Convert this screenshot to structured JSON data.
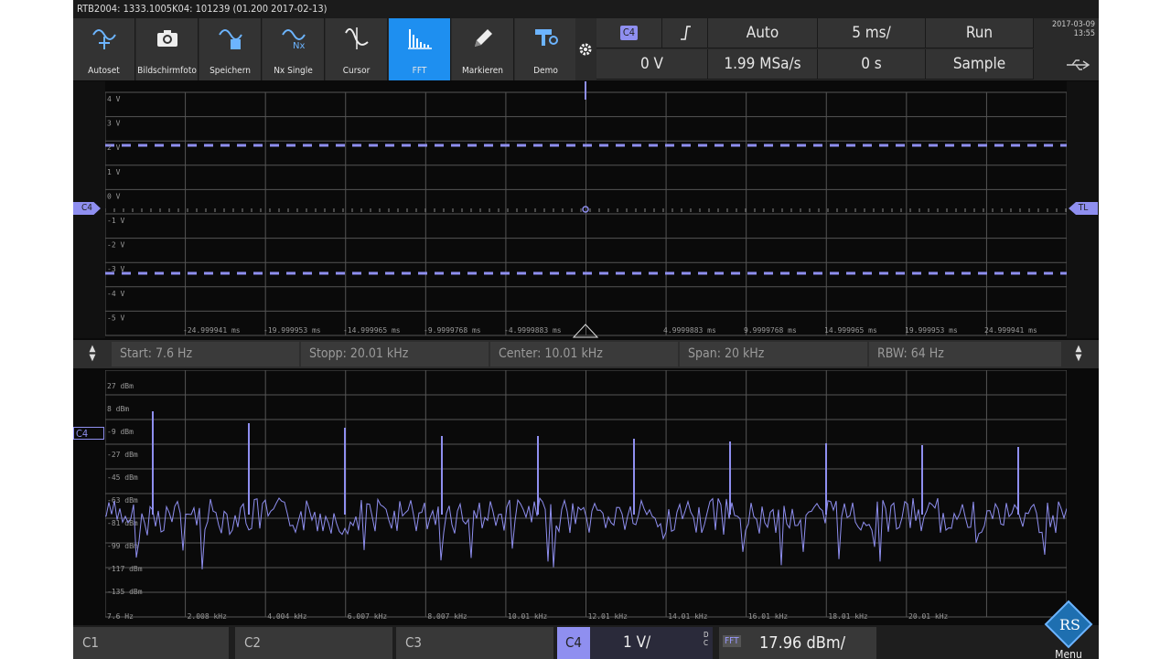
{
  "title_bar": "RTB2004: 1333.1005K04: 101239 (01.200 2017-02-13)",
  "toolbar": {
    "buttons": [
      {
        "label": "Autoset",
        "icon": "autoset-icon"
      },
      {
        "label": "Bildschirmfoto",
        "icon": "camera-icon"
      },
      {
        "label": "Speichern",
        "icon": "save-waveform-icon"
      },
      {
        "label": "Nx Single",
        "icon": "nx-single-icon"
      },
      {
        "label": "Cursor",
        "icon": "cursor-icon"
      },
      {
        "label": "FFT",
        "icon": "fft-icon"
      },
      {
        "label": "Markieren",
        "icon": "pencil-icon"
      },
      {
        "label": "Demo",
        "icon": "demo-icon"
      }
    ],
    "gear_icon": "gear-icon",
    "trigger": {
      "source": "C4",
      "slope_icon": "rising-edge-icon",
      "mode": "Auto",
      "timebase": "5 ms/",
      "run_state": "Run",
      "level": "0 V",
      "sample_rate": "1.99 MSa/s",
      "position": "0 s",
      "acquisition": "Sample"
    },
    "datetime": "2017-03-09\n13:55",
    "usb_icon": "usb-icon"
  },
  "upper_panel": {
    "channel_marker": "C4",
    "trigger_marker": "TL",
    "y_labels": [
      "4 V",
      "3 V",
      "2 V",
      "1 V",
      "0 V",
      "-1 V",
      "-2 V",
      "-3 V",
      "-4 V",
      "-5 V"
    ],
    "x_labels": [
      "-24.999941 ms",
      "-19.999953 ms",
      "-14.999965 ms",
      "-9.9999768 ms",
      "-4.9999883 ms",
      "4.9999883 ms",
      "9.9999768 ms",
      "14.999965 ms",
      "19.999953 ms",
      "24.999941 ms"
    ]
  },
  "fft_params": {
    "start": "Start: 7.6 Hz",
    "stop": "Stopp: 20.01 kHz",
    "center": "Center: 10.01 kHz",
    "span": "Span: 20 kHz",
    "rbw": "RBW: 64 Hz"
  },
  "lower_panel": {
    "channel_marker": "C4",
    "y_labels": [
      "27 dBm",
      "8 dBm",
      "-9 dBm",
      "-27 dBm",
      "-45 dBm",
      "-63 dBm",
      "-81 dBm",
      "-99 dBm",
      "-117 dBm",
      "-135 dBm"
    ],
    "x_labels": [
      "7.6 Hz",
      "2.008 kHz",
      "4.004 kHz",
      "6.007 kHz",
      "8.007 kHz",
      "10.01 kHz",
      "12.01 kHz",
      "14.01 kHz",
      "16.01 kHz",
      "18.01 kHz",
      "20.01 kHz"
    ]
  },
  "bottom_bar": {
    "c1": "C1",
    "c2": "C2",
    "c3": "C3",
    "c4": "C4",
    "c4_scale": "1 V/",
    "c4_coupling": "DC",
    "fft_tag": "FFT",
    "fft_scale": "17.96 dBm/",
    "menu_label": "Menu"
  },
  "colors": {
    "accent_blue": "#1e8ff0",
    "trace": "#8f8ff0",
    "grid": "#555555"
  }
}
